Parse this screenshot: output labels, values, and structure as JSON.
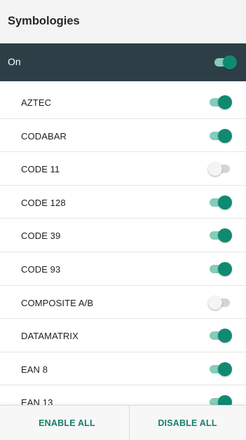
{
  "header": {
    "title": "Symbologies"
  },
  "master": {
    "label": "On",
    "enabled": true
  },
  "colors": {
    "accent": "#0f8a70",
    "accent_track": "#83cdb9",
    "header_bar": "#2e3e46",
    "off_track": "#d5d5d5"
  },
  "symbologies": [
    {
      "label": "AZTEC",
      "enabled": true
    },
    {
      "label": "CODABAR",
      "enabled": true
    },
    {
      "label": "CODE 11",
      "enabled": false
    },
    {
      "label": "CODE 128",
      "enabled": true
    },
    {
      "label": "CODE 39",
      "enabled": true
    },
    {
      "label": "CODE 93",
      "enabled": true
    },
    {
      "label": "COMPOSITE A/B",
      "enabled": false
    },
    {
      "label": "DATAMATRIX",
      "enabled": true
    },
    {
      "label": "EAN 8",
      "enabled": true
    },
    {
      "label": "EAN 13",
      "enabled": true
    }
  ],
  "footer": {
    "enable_all_label": "ENABLE ALL",
    "disable_all_label": "DISABLE ALL"
  }
}
